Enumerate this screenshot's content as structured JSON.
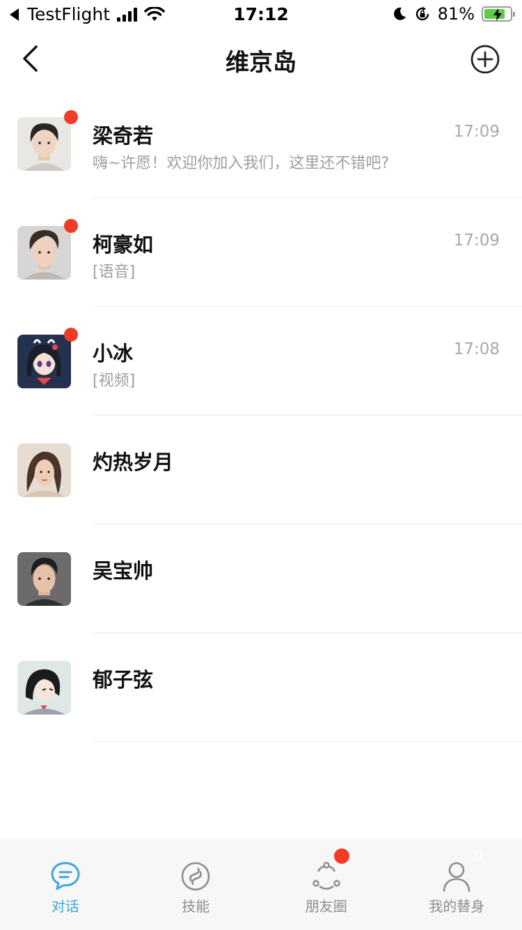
{
  "status_bar": {
    "back_app": "TestFlight",
    "time": "17:12",
    "battery_percent": "81%",
    "battery_level": 0.81,
    "icons": [
      "back-arrow-icon",
      "signal-icon",
      "wifi-icon",
      "moon-icon",
      "rotation-lock-icon",
      "battery-charging-icon"
    ]
  },
  "nav": {
    "title": "维京岛",
    "icons": [
      "chevron-left-icon",
      "plus-circle-icon"
    ]
  },
  "chats": [
    {
      "name": "梁奇若",
      "time": "17:09",
      "message": "嗨~许愿！欢迎你加入我们，这里还不错吧?",
      "unread": true
    },
    {
      "name": "柯豪如",
      "time": "17:09",
      "message": "[语音]",
      "unread": true
    },
    {
      "name": "小冰",
      "time": "17:08",
      "message": "[视频]",
      "unread": true
    },
    {
      "name": "灼热岁月",
      "time": "",
      "message": "",
      "unread": false
    },
    {
      "name": "吴宝帅",
      "time": "",
      "message": "",
      "unread": false
    },
    {
      "name": "郁子弦",
      "time": "",
      "message": "",
      "unread": false
    }
  ],
  "tabs": [
    {
      "label": "对话",
      "icon": "chat-bubble-icon",
      "active": true
    },
    {
      "label": "技能",
      "icon": "skill-icon",
      "active": false
    },
    {
      "label": "朋友圈",
      "icon": "moments-icon",
      "active": false,
      "badge": true
    },
    {
      "label": "我的替身",
      "icon": "person-icon",
      "active": false,
      "count": "0"
    }
  ],
  "colors": {
    "accent": "#3ba7d6",
    "badge_red": "#f03b26",
    "battery_green": "#5ccc46",
    "tab_bar_bg": "#f7f7f7"
  }
}
